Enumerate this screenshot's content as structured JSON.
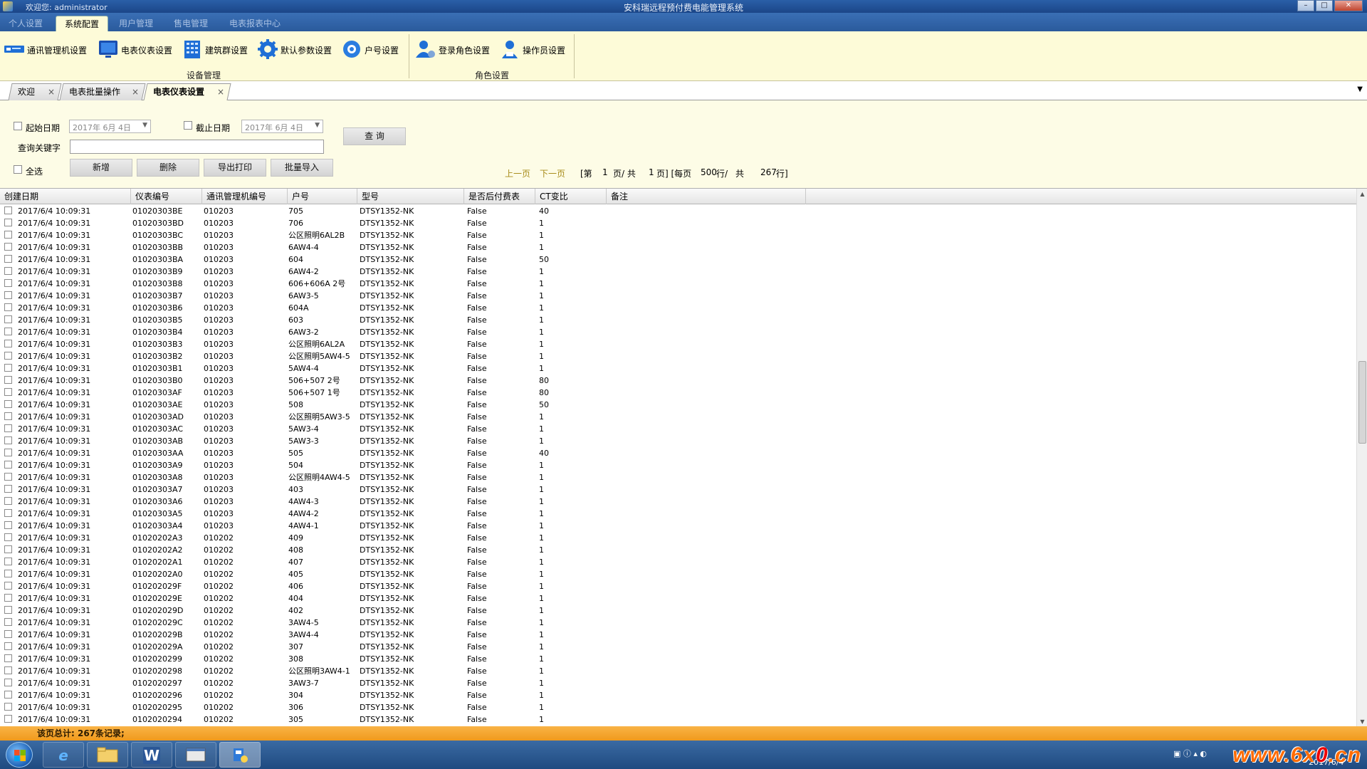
{
  "window": {
    "welcome": "欢迎您: administrator",
    "title": "安科瑞远程预付费电能管理系统"
  },
  "menu": [
    "个人设置",
    "系统配置",
    "用户管理",
    "售电管理",
    "电表报表中心"
  ],
  "ribbon": {
    "device_group": {
      "label": "设备管理",
      "buttons": [
        "通讯管理机设置",
        "电表仪表设置",
        "建筑群设置",
        "默认参数设置",
        "户号设置"
      ]
    },
    "role_group": {
      "label": "角色设置",
      "buttons": [
        "登录角色设置",
        "操作员设置"
      ]
    }
  },
  "doc_tabs": [
    "欢迎",
    "电表批量操作",
    "电表仪表设置"
  ],
  "filter": {
    "start_date_label": "起始日期",
    "start_date_value": "2017年 6月 4日",
    "end_date_label": "截止日期",
    "end_date_value": "2017年 6月 4日",
    "keyword_label": "查询关键字",
    "keyword_value": "",
    "query_button": "查 询",
    "select_all_label": "全选",
    "add_button": "新增",
    "delete_button": "删除",
    "export_button": "导出打印",
    "import_button": "批量导入"
  },
  "pager": {
    "prev": "上一页",
    "next": "下一页",
    "page_text": "[第",
    "page_current": "1",
    "page_total_text": "页/ 共",
    "page_total": "1",
    "per_page_text": "页] [每页",
    "per_page": "500",
    "rows_text": "行/",
    "total_text": "共",
    "total_rows": "267",
    "rows_suffix": "行]"
  },
  "table": {
    "columns": [
      "创建日期",
      "仪表编号",
      "通讯管理机编号",
      "户号",
      "型号",
      "是否后付费表",
      "CT变比",
      "备注"
    ],
    "rows": [
      [
        "2017/6/4 10:09:31",
        "01020303BE",
        "010203",
        "705",
        "DTSY1352-NK",
        "False",
        "40"
      ],
      [
        "2017/6/4 10:09:31",
        "01020303BD",
        "010203",
        "706",
        "DTSY1352-NK",
        "False",
        "1"
      ],
      [
        "2017/6/4 10:09:31",
        "01020303BC",
        "010203",
        "公区照明6AL2B",
        "DTSY1352-NK",
        "False",
        "1"
      ],
      [
        "2017/6/4 10:09:31",
        "01020303BB",
        "010203",
        "6AW4-4",
        "DTSY1352-NK",
        "False",
        "1"
      ],
      [
        "2017/6/4 10:09:31",
        "01020303BA",
        "010203",
        "604",
        "DTSY1352-NK",
        "False",
        "50"
      ],
      [
        "2017/6/4 10:09:31",
        "01020303B9",
        "010203",
        "6AW4-2",
        "DTSY1352-NK",
        "False",
        "1"
      ],
      [
        "2017/6/4 10:09:31",
        "01020303B8",
        "010203",
        "606+606A 2号",
        "DTSY1352-NK",
        "False",
        "1"
      ],
      [
        "2017/6/4 10:09:31",
        "01020303B7",
        "010203",
        "6AW3-5",
        "DTSY1352-NK",
        "False",
        "1"
      ],
      [
        "2017/6/4 10:09:31",
        "01020303B6",
        "010203",
        "604A",
        "DTSY1352-NK",
        "False",
        "1"
      ],
      [
        "2017/6/4 10:09:31",
        "01020303B5",
        "010203",
        "603",
        "DTSY1352-NK",
        "False",
        "1"
      ],
      [
        "2017/6/4 10:09:31",
        "01020303B4",
        "010203",
        "6AW3-2",
        "DTSY1352-NK",
        "False",
        "1"
      ],
      [
        "2017/6/4 10:09:31",
        "01020303B3",
        "010203",
        "公区照明6AL2A",
        "DTSY1352-NK",
        "False",
        "1"
      ],
      [
        "2017/6/4 10:09:31",
        "01020303B2",
        "010203",
        "公区照明5AW4-5",
        "DTSY1352-NK",
        "False",
        "1"
      ],
      [
        "2017/6/4 10:09:31",
        "01020303B1",
        "010203",
        "5AW4-4",
        "DTSY1352-NK",
        "False",
        "1"
      ],
      [
        "2017/6/4 10:09:31",
        "01020303B0",
        "010203",
        "506+507 2号",
        "DTSY1352-NK",
        "False",
        "80"
      ],
      [
        "2017/6/4 10:09:31",
        "01020303AF",
        "010203",
        "506+507 1号",
        "DTSY1352-NK",
        "False",
        "80"
      ],
      [
        "2017/6/4 10:09:31",
        "01020303AE",
        "010203",
        "508",
        "DTSY1352-NK",
        "False",
        "50"
      ],
      [
        "2017/6/4 10:09:31",
        "01020303AD",
        "010203",
        "公区照明5AW3-5",
        "DTSY1352-NK",
        "False",
        "1"
      ],
      [
        "2017/6/4 10:09:31",
        "01020303AC",
        "010203",
        "5AW3-4",
        "DTSY1352-NK",
        "False",
        "1"
      ],
      [
        "2017/6/4 10:09:31",
        "01020303AB",
        "010203",
        "5AW3-3",
        "DTSY1352-NK",
        "False",
        "1"
      ],
      [
        "2017/6/4 10:09:31",
        "01020303AA",
        "010203",
        "505",
        "DTSY1352-NK",
        "False",
        "40"
      ],
      [
        "2017/6/4 10:09:31",
        "01020303A9",
        "010203",
        "504",
        "DTSY1352-NK",
        "False",
        "1"
      ],
      [
        "2017/6/4 10:09:31",
        "01020303A8",
        "010203",
        "公区照明4AW4-5",
        "DTSY1352-NK",
        "False",
        "1"
      ],
      [
        "2017/6/4 10:09:31",
        "01020303A7",
        "010203",
        "403",
        "DTSY1352-NK",
        "False",
        "1"
      ],
      [
        "2017/6/4 10:09:31",
        "01020303A6",
        "010203",
        "4AW4-3",
        "DTSY1352-NK",
        "False",
        "1"
      ],
      [
        "2017/6/4 10:09:31",
        "01020303A5",
        "010203",
        "4AW4-2",
        "DTSY1352-NK",
        "False",
        "1"
      ],
      [
        "2017/6/4 10:09:31",
        "01020303A4",
        "010203",
        "4AW4-1",
        "DTSY1352-NK",
        "False",
        "1"
      ],
      [
        "2017/6/4 10:09:31",
        "01020202A3",
        "010202",
        "409",
        "DTSY1352-NK",
        "False",
        "1"
      ],
      [
        "2017/6/4 10:09:31",
        "01020202A2",
        "010202",
        "408",
        "DTSY1352-NK",
        "False",
        "1"
      ],
      [
        "2017/6/4 10:09:31",
        "01020202A1",
        "010202",
        "407",
        "DTSY1352-NK",
        "False",
        "1"
      ],
      [
        "2017/6/4 10:09:31",
        "01020202A0",
        "010202",
        "405",
        "DTSY1352-NK",
        "False",
        "1"
      ],
      [
        "2017/6/4 10:09:31",
        "010202029F",
        "010202",
        "406",
        "DTSY1352-NK",
        "False",
        "1"
      ],
      [
        "2017/6/4 10:09:31",
        "010202029E",
        "010202",
        "404",
        "DTSY1352-NK",
        "False",
        "1"
      ],
      [
        "2017/6/4 10:09:31",
        "010202029D",
        "010202",
        "402",
        "DTSY1352-NK",
        "False",
        "1"
      ],
      [
        "2017/6/4 10:09:31",
        "010202029C",
        "010202",
        "3AW4-5",
        "DTSY1352-NK",
        "False",
        "1"
      ],
      [
        "2017/6/4 10:09:31",
        "010202029B",
        "010202",
        "3AW4-4",
        "DTSY1352-NK",
        "False",
        "1"
      ],
      [
        "2017/6/4 10:09:31",
        "010202029A",
        "010202",
        "307",
        "DTSY1352-NK",
        "False",
        "1"
      ],
      [
        "2017/6/4 10:09:31",
        "0102020299",
        "010202",
        "308",
        "DTSY1352-NK",
        "False",
        "1"
      ],
      [
        "2017/6/4 10:09:31",
        "0102020298",
        "010202",
        "公区照明3AW4-1",
        "DTSY1352-NK",
        "False",
        "1"
      ],
      [
        "2017/6/4 10:09:31",
        "0102020297",
        "010202",
        "3AW3-7",
        "DTSY1352-NK",
        "False",
        "1"
      ],
      [
        "2017/6/4 10:09:31",
        "0102020296",
        "010202",
        "304",
        "DTSY1352-NK",
        "False",
        "1"
      ],
      [
        "2017/6/4 10:09:31",
        "0102020295",
        "010202",
        "306",
        "DTSY1352-NK",
        "False",
        "1"
      ],
      [
        "2017/6/4 10:09:31",
        "0102020294",
        "010202",
        "305",
        "DTSY1352-NK",
        "False",
        "1"
      ]
    ]
  },
  "status": {
    "text": "该页总计: 267条记录;"
  },
  "taskbar": {
    "date": "2017/6/4",
    "watermark_prefix": "www.6x",
    "watermark_zero": "0",
    "watermark_suffix": ".cn"
  },
  "colors": {
    "accent": "#2a5a9c",
    "panel": "#fdfbd8",
    "statusbar": "#f4a52a",
    "link": "#a88c1a"
  }
}
